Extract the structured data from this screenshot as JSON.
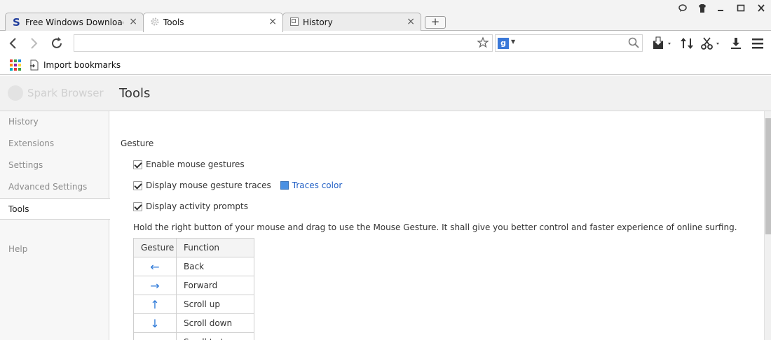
{
  "tabs": [
    {
      "title": "Free Windows Downloads",
      "favicon": "softpedia-s-icon",
      "active": false
    },
    {
      "title": "Tools",
      "favicon": "gear-icon",
      "active": true
    },
    {
      "title": "History",
      "favicon": "page-icon",
      "active": false
    }
  ],
  "new_tab_label": "+",
  "window_controls": {
    "feedback": "feedback-icon",
    "skin": "shirt-icon",
    "minimize": "minimize-icon",
    "maximize": "maximize-icon",
    "close": "close-icon"
  },
  "toolbar": {
    "address_value": "",
    "search_engine": "g",
    "search_value": "",
    "icons": [
      "back-icon",
      "forward-icon",
      "reload-icon",
      "star-icon",
      "search-icon",
      "media-download-icon",
      "sync-icon",
      "cut-icon",
      "download-icon",
      "menu-icon"
    ]
  },
  "bookmarks": {
    "import_label": "Import bookmarks",
    "app_colors": [
      "#e53935",
      "#43a047",
      "#1e88e5",
      "#fb8c00",
      "#8e24aa",
      "#fdd835",
      "#00acc1",
      "#e53935",
      "#43a047"
    ]
  },
  "header": {
    "brand": "Spark Browser",
    "title": "Tools"
  },
  "sidebar": {
    "items": [
      {
        "label": "History",
        "active": false
      },
      {
        "label": "Extensions",
        "active": false
      },
      {
        "label": "Settings",
        "active": false
      },
      {
        "label": "Advanced Settings",
        "active": false
      },
      {
        "label": "Tools",
        "active": true
      },
      {
        "label": "Help",
        "active": false
      }
    ]
  },
  "gesture": {
    "section_title": "Gesture",
    "options": [
      {
        "label": "Enable mouse gestures",
        "checked": true
      },
      {
        "label": "Display mouse gesture traces",
        "checked": true
      },
      {
        "label": "Display activity prompts",
        "checked": true
      }
    ],
    "traces_color_label": "Traces color",
    "traces_color": "#4a90e2",
    "description": "Hold the right button of your mouse and drag to use the Mouse Gesture. It shall give you better control and faster experience of online surfing.",
    "table": {
      "headers": [
        "Gesture",
        "Function"
      ],
      "rows": [
        {
          "gesture": "←",
          "function": "Back"
        },
        {
          "gesture": "→",
          "function": "Forward"
        },
        {
          "gesture": "↑",
          "function": "Scroll up"
        },
        {
          "gesture": "↓",
          "function": "Scroll down"
        },
        {
          "gesture": "←",
          "function": "Scroll to top"
        }
      ]
    }
  }
}
